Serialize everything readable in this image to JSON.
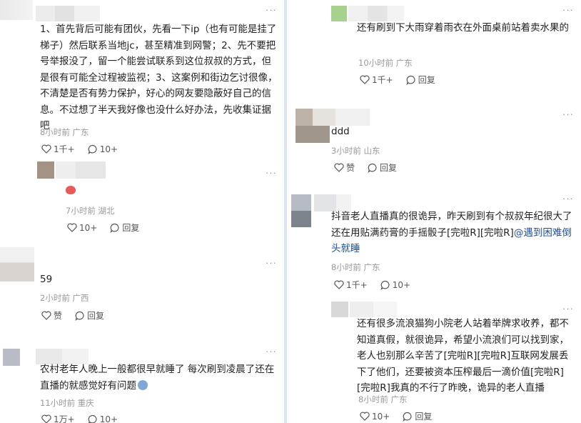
{
  "left": [
    {
      "text": "1、首先背后可能有团伙，先看一下ip（也有可能是挂了梯子）然后联系当地jc，甚至精准到网警；2、先不要把号举报没了，留一个能尝试联系到这位叔叔的方式，但是很有可能全过程被监视；3、这案例和街边乞讨很像，不清楚是否有势力保护，好心的网友要隐蔽好自己的信息。不过想了半天我好像也没什么好办法，先收集证据吧",
      "time": "8小时前",
      "loc": "广东",
      "like": "1千+",
      "reply": "10+"
    },
    {
      "text": "",
      "time": "7小时前",
      "loc": "湖北",
      "like": "10+",
      "reply": "回复"
    },
    {
      "text": "59",
      "time": "2小时前",
      "loc": "广西",
      "like": "赞",
      "reply": "回复"
    },
    {
      "text": "农村老年人晚上一般都很早就睡了 每次刷到凌晨了还在直播的就感觉好有问题",
      "time": "11小时前",
      "loc": "重庆",
      "like": "1万+",
      "reply": "10+"
    }
  ],
  "right": [
    {
      "text": "还有刷到下大雨穿着雨衣在外面桌前站着卖水果的",
      "time": "10小时前",
      "loc": "广东",
      "like": "1千+",
      "reply": "回复"
    },
    {
      "text": "ddd",
      "time": "3小时前",
      "loc": "山东",
      "like": "赞",
      "reply": "回复"
    },
    {
      "text": "抖音老人直播真的很诡异，昨天刷到有个叔叔年纪很大了还在用贴满药膏的手摇骰子[完啦R][完啦R]",
      "mention": "@遇到困难倒头就睡",
      "time": "8小时前",
      "loc": "广东",
      "like": "1千+",
      "reply": "10+"
    },
    {
      "text": "还有很多流浪猫狗小院老人站着举牌求收养，都不知道真假，就很诡异，希望小流浪们可以找到家，老人也别那么辛苦了[完啦R][完啦R]互联网发展丢下了他们，还要被资本压榨最后一滴价值[完啦R][完啦R]我真的不行了昨晚，诡异的老人直播",
      "time": "8小时前",
      "loc": "广东",
      "like": "10+",
      "reply": "回复"
    }
  ],
  "more_label": "···",
  "emoji_reaction": "hand-icon",
  "trailing_emoji": "worried-face-icon"
}
